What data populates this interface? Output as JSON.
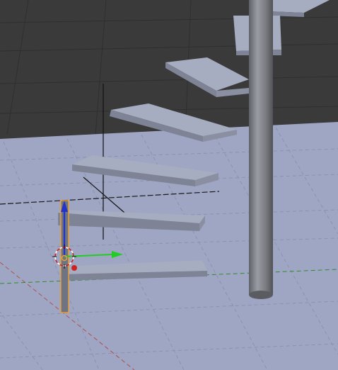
{
  "viewport": {
    "colors": {
      "background_dark": "#3a3a3a",
      "grid_dark": "#2f2f2f",
      "floor": "#9ea6c3",
      "grid_floor": "#8c94b2",
      "axis_x_red": "#b25050",
      "axis_y_green": "#2f8c2f",
      "transform_z_blue": "#2233cc",
      "transform_y_green": "#22cc22",
      "selection_orange": "#f0a030",
      "step_top": "#a6adc0",
      "step_side": "#7e8495",
      "pole_dark": "#5e6066",
      "pole_light": "#9a9ca4"
    },
    "objects": [
      {
        "name": "spiral-stair-pole"
      },
      {
        "name": "stair-step-1"
      },
      {
        "name": "stair-step-2"
      },
      {
        "name": "stair-step-3"
      },
      {
        "name": "stair-step-4"
      },
      {
        "name": "stair-step-5"
      },
      {
        "name": "stair-step-6"
      },
      {
        "name": "stair-step-7"
      },
      {
        "name": "selected-object"
      }
    ],
    "widgets": [
      "3d-cursor-icon",
      "transform-manipulator",
      "empty-axes"
    ]
  }
}
